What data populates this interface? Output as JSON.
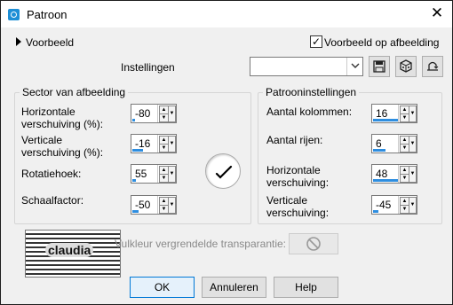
{
  "window": {
    "title": "Patroon",
    "close_glyph": "✕"
  },
  "preview": {
    "label": "Voorbeeld",
    "checkbox_label": "Voorbeeld op afbeelding",
    "checked": true
  },
  "settings": {
    "label": "Instellingen",
    "combo_value": ""
  },
  "left_group": {
    "title": "Sector van afbeelding",
    "fields": [
      {
        "label_line1": "Horizontale",
        "label_line2": "verschuiving (%):",
        "value": "-80",
        "fill_pct": 10
      },
      {
        "label_line1": "Verticale",
        "label_line2": "verschuiving (%):",
        "value": "-16",
        "fill_pct": 42
      },
      {
        "label_line1": "Rotatiehoek:",
        "label_line2": "",
        "value": "55",
        "fill_pct": 15
      },
      {
        "label_line1": "Schaalfactor:",
        "label_line2": "",
        "value": "-50",
        "fill_pct": 25
      }
    ]
  },
  "right_group": {
    "title": "Patrooninstellingen",
    "fields": [
      {
        "label_line1": "Aantal kolommen:",
        "label_line2": "",
        "value": "16",
        "fill_pct": 100
      },
      {
        "label_line1": "Aantal rijen:",
        "label_line2": "",
        "value": "6",
        "fill_pct": 50
      },
      {
        "label_line1": "Horizontale",
        "label_line2": "verschuiving:",
        "value": "48",
        "fill_pct": 100
      },
      {
        "label_line1": "Verticale",
        "label_line2": "verschuiving:",
        "value": "-45",
        "fill_pct": 20
      }
    ]
  },
  "transparency": {
    "label": "Vulkleur vergrendelde transparantie:"
  },
  "logo": {
    "text": "claudia"
  },
  "buttons": {
    "ok": "OK",
    "cancel": "Annuleren",
    "help": "Help"
  },
  "colors": {
    "accent": "#2e8ee0",
    "icon_blue": "#1e8fd6"
  },
  "icons": [
    "app-icon",
    "close-icon",
    "expand-triangle-icon",
    "checkbox-check-icon",
    "combo-arrow-icon",
    "save-icon",
    "random-dice-icon",
    "reset-icon",
    "spin-up-icon",
    "spin-down-icon",
    "no-entry-icon"
  ]
}
